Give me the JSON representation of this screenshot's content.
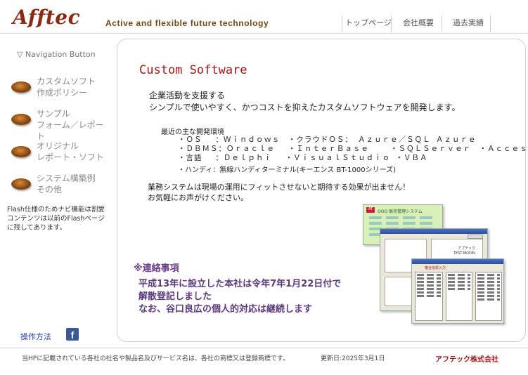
{
  "header": {
    "logo": "Afftec",
    "tagline": "Active and flexible future technology",
    "nav": [
      "トップページ",
      "会社概要",
      "過去実績"
    ]
  },
  "sidebar": {
    "title": "▽ Navigation Button",
    "items": [
      {
        "label": "カスタムソフト\n作成ポリシー"
      },
      {
        "label": "サンプル\nフォーム／レポート"
      },
      {
        "label": "オリジナル\nレポート・ソフト"
      },
      {
        "label": "システム構築例\nその他"
      }
    ],
    "flash_note": "Flash仕様のためナビ機能は割愛\nコンテンツは以前のFlashページ\nに残してあります。",
    "howto": "操作方法",
    "facebook_icon": "facebook-icon"
  },
  "main": {
    "title": "Custom Software",
    "intro": "企業活動を支援する\nシンプルで使いやすく、かつコストを抑えたカスタムソフトウェアを開発します。",
    "env_heading": "最近の主な開発環境",
    "spec_lines": [
      "・ＯＳ　 ：Ｗｉｎｄｏｗｓ　・クラウドＯＳ： Ａｚｕｒｅ／ＳＱＬ Ａｚｕｒｅ",
      "・ＤＢＭＳ：Ｏｒａｃｌｅ　 ・ＩｎｔｅｒＢａｓｅ　　 ・ＳＱＬＳｅｒｖｅｒ　・Ａｃｃｅｓｓ",
      "・言語　 ：Ｄｅｌｐｈｉ　 ・ＶｉｓｕａｌＳｔｕｄｉｏ ・ＶＢＡ"
    ],
    "handy": "・ハンディ：無線ハンディターミナル(キーエンス BT-1000シリーズ)",
    "closing": "業務システムは現場の運用にフィットさせないと期待する効果が出ません！\nお気軽にお声がけください。",
    "notice_heading": "※連絡事項",
    "notice_body": "平成13年に設立した本社は令年7年1月22日付で\n解散登記しました\nなお、谷口良広の個人的対応は継続します",
    "screens": {
      "s1_title": "OOO 販売管理システム",
      "s1_logo": "AT",
      "s2_label": "アプテック",
      "s2_model": "TEST-MODEL",
      "s3_label": "複合伝票入力"
    }
  },
  "footer": {
    "note": "当HPに記載されている各社の社名や製品名及びサービス名は、各社の商標又は登録商標です。",
    "updated": "更新日:2025年3月1日",
    "company": "アフテック株式会社"
  }
}
